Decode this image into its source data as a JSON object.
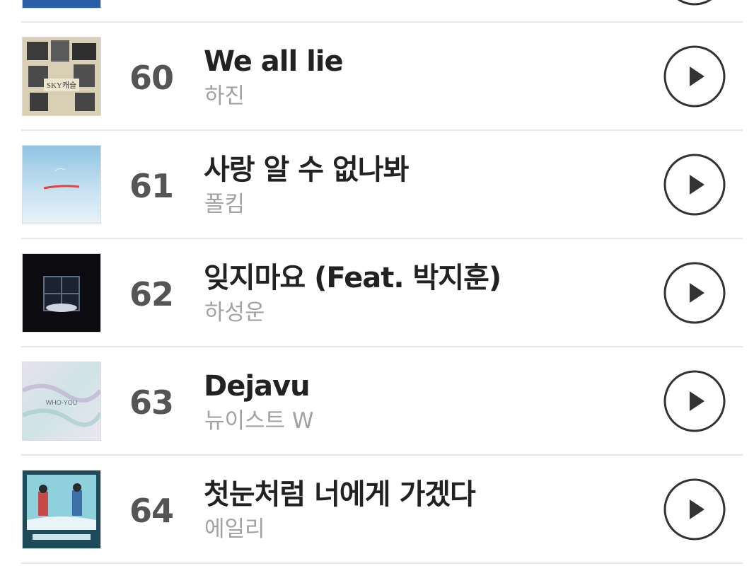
{
  "chart_list": {
    "rows": [
      {
        "rank": "60",
        "title": "We all lie",
        "artist": "하진"
      },
      {
        "rank": "61",
        "title": "사랑 알 수 없나봐",
        "artist": "폴킴"
      },
      {
        "rank": "62",
        "title": "잊지마요 (Feat. 박지훈)",
        "artist": "하성운"
      },
      {
        "rank": "63",
        "title": "Dejavu",
        "artist": "뉴이스트 W"
      },
      {
        "rank": "64",
        "title": "첫눈처럼 너에게 가겠다",
        "artist": "에일리"
      }
    ],
    "icons": {
      "play": "play-circle-icon"
    },
    "colors": {
      "title": "#222222",
      "artist": "#a2a2a2",
      "rank": "#555555",
      "divider": "#e6e6e6",
      "icon": "#333333"
    }
  }
}
